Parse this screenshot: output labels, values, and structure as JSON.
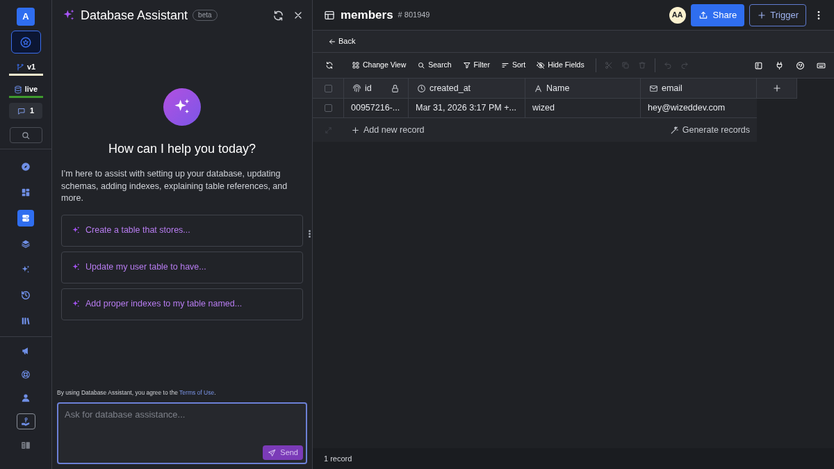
{
  "rail": {
    "avatar": "A",
    "workspace_selected": true,
    "branch": "v1",
    "environment": "live",
    "comments": "1",
    "nav": [
      {
        "selected": false
      },
      {
        "selected": false
      },
      {
        "selected": true
      },
      {
        "selected": false
      },
      {
        "selected": false
      },
      {
        "selected": false
      },
      {
        "selected": false
      }
    ],
    "nav_bottom": [
      {
        "outlined": false
      },
      {
        "outlined": false
      },
      {
        "outlined": false
      },
      {
        "outlined": true
      },
      {
        "outlined": false
      }
    ]
  },
  "assistant": {
    "title": "Database Assistant",
    "badge": "beta",
    "heading": "How can I help you today?",
    "intro": "I’m here to assist with setting up your database, updating schemas, adding indexes, explaining table references, and more.",
    "suggestions": [
      "Create a table that stores...",
      "Update my user table to have...",
      "Add proper indexes to my table named..."
    ],
    "disclaimer": "By using Database Assistant, you agree to the",
    "terms_link": "Terms of Use",
    "disclaimer_end": ".",
    "input": {
      "placeholder": "Ask for database assistance..."
    },
    "send": "Send"
  },
  "main": {
    "title": "members",
    "table_id": "# 801949",
    "user_initials": "AA",
    "share": "Share",
    "trigger": "Trigger",
    "back": "Back",
    "toolbar": [
      {
        "disabled": false
      },
      {
        "label": "Change View",
        "disabled": false
      },
      {
        "label": "Search",
        "disabled": false
      },
      {
        "label": "Filter",
        "disabled": false
      },
      {
        "label": "Sort",
        "disabled": false
      },
      {
        "label": "Hide Fields",
        "disabled": false
      },
      {
        "disabled": true
      },
      {
        "disabled": true
      },
      {
        "disabled": true
      },
      {
        "disabled": true
      },
      {
        "disabled": true
      }
    ],
    "table": {
      "columns": [
        "id",
        "created_at",
        "Name",
        "email"
      ],
      "select_all_checked": false,
      "rows": [
        {
          "checked": false,
          "cells": [
            "00957216-...",
            "Mar 31, 2026 3:17 PM +...",
            "wized",
            "hey@wizeddev.com"
          ]
        }
      ],
      "add_record": "Add new record",
      "generate": "Generate records"
    },
    "status_bar": "1 record"
  }
}
